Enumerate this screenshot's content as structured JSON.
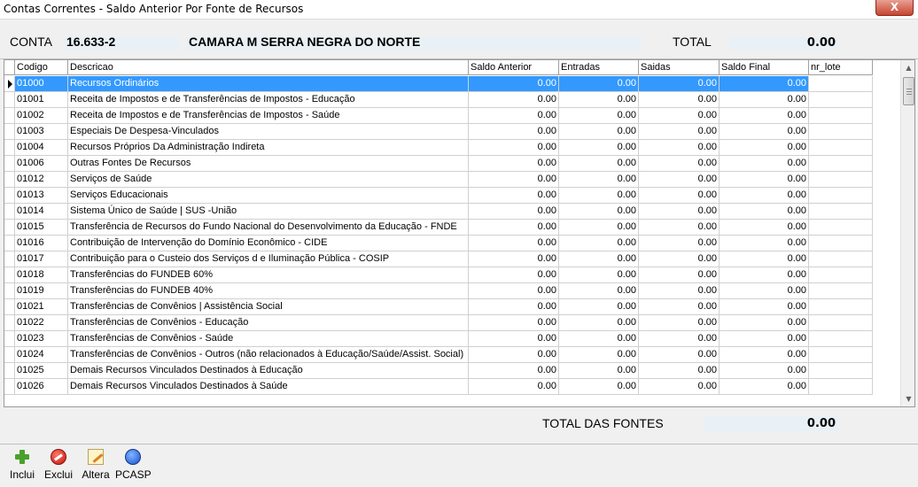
{
  "window": {
    "title": "Contas Correntes - Saldo Anterior Por Fonte de Recursos",
    "close_label": "X"
  },
  "header": {
    "conta_label": "CONTA",
    "conta_value": "16.633-2",
    "entidade": "CAMARA M SERRA NEGRA DO NORTE",
    "total_label": "TOTAL",
    "total_value": "0.00"
  },
  "grid": {
    "columns": [
      "Codigo",
      "Descricao",
      "Saldo Anterior",
      "Entradas",
      "Saidas",
      "Saldo Final",
      "nr_lote"
    ],
    "rows": [
      {
        "codigo": "01000",
        "descricao": "Recursos Ordinários",
        "saldo_anterior": "0.00",
        "entradas": "0.00",
        "saidas": "0.00",
        "saldo_final": "0.00",
        "nr_lote": ""
      },
      {
        "codigo": "01001",
        "descricao": "Receita de Impostos e de Transferências de Impostos - Educação",
        "saldo_anterior": "0.00",
        "entradas": "0.00",
        "saidas": "0.00",
        "saldo_final": "0.00",
        "nr_lote": ""
      },
      {
        "codigo": "01002",
        "descricao": "Receita de Impostos e de Transferências de Impostos - Saúde",
        "saldo_anterior": "0.00",
        "entradas": "0.00",
        "saidas": "0.00",
        "saldo_final": "0.00",
        "nr_lote": ""
      },
      {
        "codigo": "01003",
        "descricao": "Especiais De Despesa-Vinculados",
        "saldo_anterior": "0.00",
        "entradas": "0.00",
        "saidas": "0.00",
        "saldo_final": "0.00",
        "nr_lote": ""
      },
      {
        "codigo": "01004",
        "descricao": "Recursos Próprios Da Administração Indireta",
        "saldo_anterior": "0.00",
        "entradas": "0.00",
        "saidas": "0.00",
        "saldo_final": "0.00",
        "nr_lote": ""
      },
      {
        "codigo": "01006",
        "descricao": "Outras Fontes De Recursos",
        "saldo_anterior": "0.00",
        "entradas": "0.00",
        "saidas": "0.00",
        "saldo_final": "0.00",
        "nr_lote": ""
      },
      {
        "codigo": "01012",
        "descricao": "Serviços de Saúde",
        "saldo_anterior": "0.00",
        "entradas": "0.00",
        "saidas": "0.00",
        "saldo_final": "0.00",
        "nr_lote": ""
      },
      {
        "codigo": "01013",
        "descricao": "Serviços Educacionais",
        "saldo_anterior": "0.00",
        "entradas": "0.00",
        "saidas": "0.00",
        "saldo_final": "0.00",
        "nr_lote": ""
      },
      {
        "codigo": "01014",
        "descricao": "Sistema Único de Saúde | SUS -União",
        "saldo_anterior": "0.00",
        "entradas": "0.00",
        "saidas": "0.00",
        "saldo_final": "0.00",
        "nr_lote": ""
      },
      {
        "codigo": "01015",
        "descricao": "Transferência de Recursos do Fundo Nacional do Desenvolvimento da Educação - FNDE",
        "saldo_anterior": "0.00",
        "entradas": "0.00",
        "saidas": "0.00",
        "saldo_final": "0.00",
        "nr_lote": ""
      },
      {
        "codigo": "01016",
        "descricao": "Contribuição de Intervenção do Domínio Econômico - CIDE",
        "saldo_anterior": "0.00",
        "entradas": "0.00",
        "saidas": "0.00",
        "saldo_final": "0.00",
        "nr_lote": ""
      },
      {
        "codigo": "01017",
        "descricao": "Contribuição para o Custeio dos Serviços d e Iluminação Pública - COSIP",
        "saldo_anterior": "0.00",
        "entradas": "0.00",
        "saidas": "0.00",
        "saldo_final": "0.00",
        "nr_lote": ""
      },
      {
        "codigo": "01018",
        "descricao": "Transferências do FUNDEB 60%",
        "saldo_anterior": "0.00",
        "entradas": "0.00",
        "saidas": "0.00",
        "saldo_final": "0.00",
        "nr_lote": ""
      },
      {
        "codigo": "01019",
        "descricao": "Transferências do FUNDEB 40%",
        "saldo_anterior": "0.00",
        "entradas": "0.00",
        "saidas": "0.00",
        "saldo_final": "0.00",
        "nr_lote": ""
      },
      {
        "codigo": "01021",
        "descricao": "Transferências de Convênios | Assistência Social",
        "saldo_anterior": "0.00",
        "entradas": "0.00",
        "saidas": "0.00",
        "saldo_final": "0.00",
        "nr_lote": ""
      },
      {
        "codigo": "01022",
        "descricao": "Transferências de Convênios - Educação",
        "saldo_anterior": "0.00",
        "entradas": "0.00",
        "saidas": "0.00",
        "saldo_final": "0.00",
        "nr_lote": ""
      },
      {
        "codigo": "01023",
        "descricao": "Transferências de Convênios - Saúde",
        "saldo_anterior": "0.00",
        "entradas": "0.00",
        "saidas": "0.00",
        "saldo_final": "0.00",
        "nr_lote": ""
      },
      {
        "codigo": "01024",
        "descricao": "Transferências de Convênios - Outros (não relacionados à Educação/Saúde/Assist. Social)",
        "saldo_anterior": "0.00",
        "entradas": "0.00",
        "saidas": "0.00",
        "saldo_final": "0.00",
        "nr_lote": ""
      },
      {
        "codigo": "01025",
        "descricao": "Demais Recursos Vinculados Destinados à Educação",
        "saldo_anterior": "0.00",
        "entradas": "0.00",
        "saidas": "0.00",
        "saldo_final": "0.00",
        "nr_lote": ""
      },
      {
        "codigo": "01026",
        "descricao": "Demais Recursos Vinculados Destinados à Saúde",
        "saldo_anterior": "0.00",
        "entradas": "0.00",
        "saidas": "0.00",
        "saldo_final": "0.00",
        "nr_lote": ""
      }
    ],
    "selected_row": 0
  },
  "footer": {
    "total_fontes_label": "TOTAL DAS FONTES",
    "total_fontes_value": "0.00"
  },
  "toolbar": {
    "buttons": [
      {
        "label": "Inclui",
        "icon": "plus-icon"
      },
      {
        "label": "Exclui",
        "icon": "delete-icon"
      },
      {
        "label": "Altera",
        "icon": "edit-icon"
      },
      {
        "label": "PCASP",
        "icon": "globe-icon"
      }
    ]
  },
  "colors": {
    "selection": "#3399ff",
    "value_box": "#e9f1f6",
    "window_bg": "#f0f0f0",
    "close_button": "#c7452f"
  }
}
